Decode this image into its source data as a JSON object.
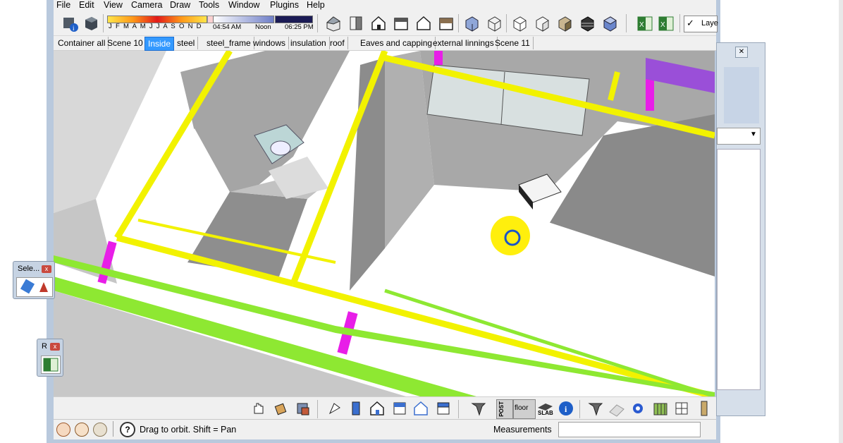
{
  "menu": {
    "items": [
      "File",
      "Edit",
      "View",
      "Camera",
      "Draw",
      "Tools",
      "Window",
      "Plugins",
      "Help"
    ]
  },
  "shadow_settings": {
    "months_label": "J F M A M J J A S O N D",
    "time_start": "04:54 AM",
    "time_mid": "Noon",
    "time_end": "06:25 PM"
  },
  "layers_toolbar": {
    "label": "Laye"
  },
  "scenes": {
    "tabs": [
      "Container all",
      "Scene 10",
      "Inside",
      "steel",
      "steel_frame",
      "windows",
      "insulation",
      "roof",
      "Eaves and capping",
      "external linnings",
      "Scene 11"
    ],
    "active": "Inside"
  },
  "toolbar_icons": {
    "left": [
      "model-info-icon",
      "component-icon"
    ],
    "views": [
      "house-iso-icon",
      "front-view-icon",
      "house-front-icon",
      "house-side-icon",
      "house-outline-icon",
      "house-back-icon"
    ],
    "styles": [
      "xray-icon",
      "wireframe-icon",
      "hidden-line-icon",
      "shaded-icon",
      "shaded-texture-icon",
      "monochrome-icon"
    ],
    "excel": [
      "excel-icon",
      "excel-alt-icon"
    ]
  },
  "bottom_toolbar": {
    "icons": [
      "hand-icon",
      "bucket-icon",
      "paint-icon",
      "section-icon",
      "door-icon",
      "house-icon",
      "window-blue-icon",
      "house-outline-icon",
      "window-icon",
      "beam-icon",
      "post-icon",
      "floor-icon",
      "slab-icon",
      "info-icon",
      "beam-alt-icon",
      "roof-icon",
      "gear-icon",
      "wall-icon",
      "grid-icon",
      "door-panel-icon"
    ],
    "floor_label": "floor",
    "post_label": "POST",
    "slab_label": "SLAB"
  },
  "status": {
    "help_text": "Drag to orbit.  Shift = Pan",
    "measurements_label": "Measurements"
  },
  "floating": {
    "select_title": "Sele...",
    "r_title": "R"
  },
  "colors": {
    "steel_yellow": "#f2f200",
    "steel_magenta": "#e81ee8",
    "steel_green": "#8ee832",
    "steel_purple": "#9a4fd8",
    "cursor_highlight": "#ffee00",
    "active_tab": "#3399ff"
  }
}
